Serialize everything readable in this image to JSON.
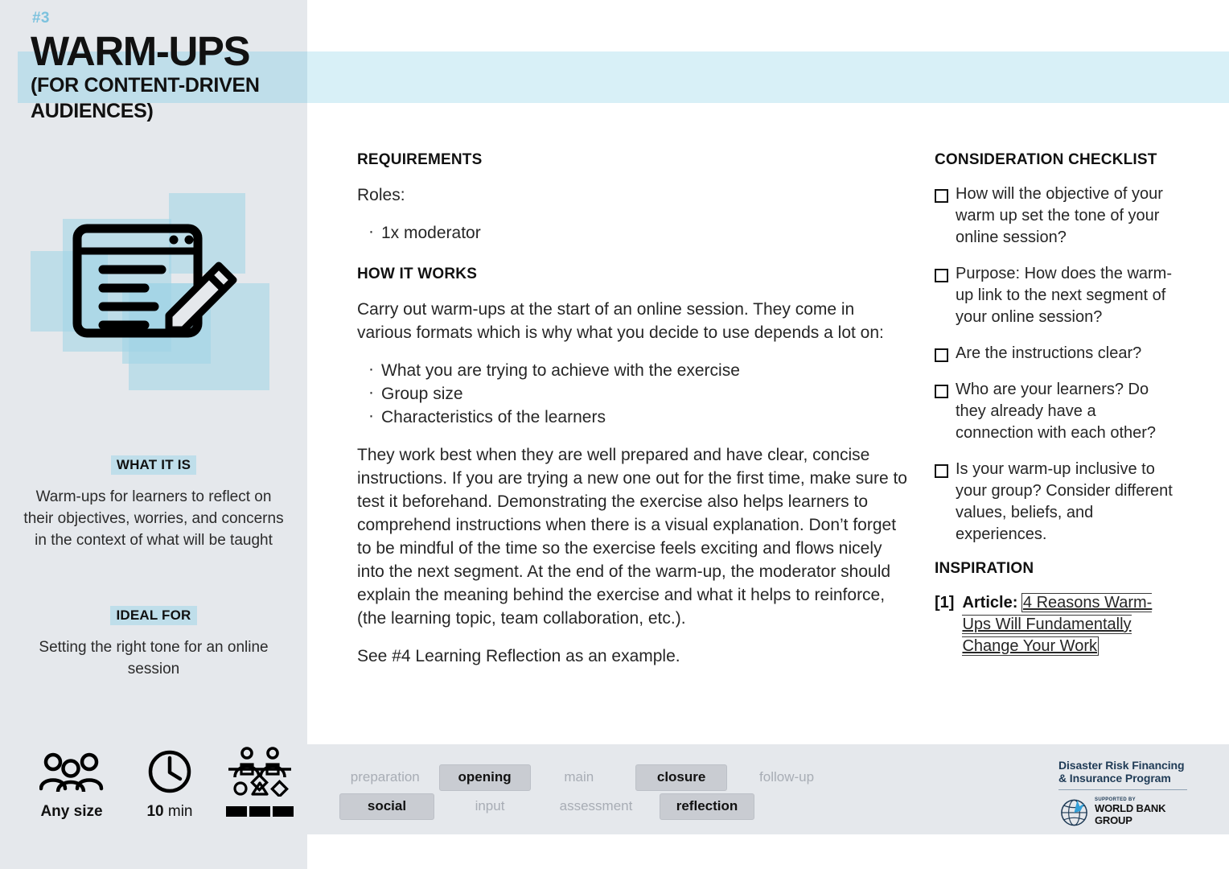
{
  "card": {
    "number": "#3",
    "title": "WARM-UPS",
    "subtitle": "(FOR CONTENT-DRIVEN AUDIENCES)"
  },
  "sidebar": {
    "illustration_icon": "browser-window-with-pencil-icon",
    "what_it_is_label": "WHAT IT IS",
    "what_it_is_text": "Warm-ups for learners to reflect on their objectives, worries, and concerns in the context of what will be taught",
    "ideal_for_label": "IDEAL FOR",
    "ideal_for_text": "Setting the right tone for an online session",
    "meta": [
      {
        "icon": "group-of-people-icon",
        "value": "Any size",
        "unit": ""
      },
      {
        "icon": "clock-icon",
        "value": "10",
        "unit": " min"
      },
      {
        "icon": "collaboration-complexity-icon",
        "value": "",
        "unit": "",
        "bars": 3
      }
    ]
  },
  "main": {
    "requirements_heading": "REQUIREMENTS",
    "roles_label": "Roles:",
    "roles": [
      "1x moderator"
    ],
    "how_it_works_heading": "HOW IT WORKS",
    "intro": "Carry out warm-ups at the start of an online session. They come in various formats which is why what you decide to use depends a lot on:",
    "factors": [
      "What you are trying to achieve with the exercise",
      "Group size",
      "Characteristics of the learners"
    ],
    "body": "They work best when they are well prepared and have clear, concise instructions. If you are trying a new one out for the first time, make sure to test it beforehand. Demonstrating the exercise also helps learners to comprehend instructions when there is a visual explanation. Don’t forget to be mindful of the time so the exercise feels exciting and flows nicely into the next segment. At the end of the warm-up, the moderator should explain the meaning behind the exercise and what it helps to reinforce, (the learning topic, team collaboration, etc.).",
    "see_also": "See #4 Learning Reflection as an example."
  },
  "checklist": {
    "heading": "CONSIDERATION CHECKLIST",
    "items": [
      "How will the objective of your warm up set the tone of your online session?",
      "Purpose: How does the warm-up link to the next segment of your online session?",
      "Are the instructions clear?",
      "Who are your learners? Do they already have a connection with each other?",
      "Is your warm-up inclusive to your group? Consider different values, beliefs, and experiences."
    ]
  },
  "inspiration": {
    "heading": "INSPIRATION",
    "ref": "[1]",
    "label": "Article:",
    "link_text": "4 Reasons Warm-Ups Will Fundamentally Change Your Work"
  },
  "footer": {
    "tags_row1": [
      {
        "label": "preparation",
        "active": false
      },
      {
        "label": "opening",
        "active": true
      },
      {
        "label": "main",
        "active": false
      },
      {
        "label": "closure",
        "active": true
      },
      {
        "label": "follow-up",
        "active": false
      }
    ],
    "tags_row2": [
      {
        "label": "social",
        "active": true
      },
      {
        "label": "input",
        "active": false
      },
      {
        "label": "assessment",
        "active": false
      },
      {
        "label": "reflection",
        "active": true
      }
    ],
    "logo_program": "Disaster Risk Financing\n& Insurance Program",
    "logo_program_line1": "Disaster Risk Financing",
    "logo_program_line2": "& Insurance Program",
    "logo_supported_by": "SUPPORTED BY",
    "logo_worldbank": "WORLD BANK GROUP"
  },
  "colors": {
    "sidebar_bg": "#e5e8ec",
    "band_left": "#bfdeea",
    "band_right": "#d8f0f7",
    "accent_blue": "#7cc2de",
    "tag_active": "#c9ccd2",
    "tag_inactive_text": "#a8adb5"
  }
}
